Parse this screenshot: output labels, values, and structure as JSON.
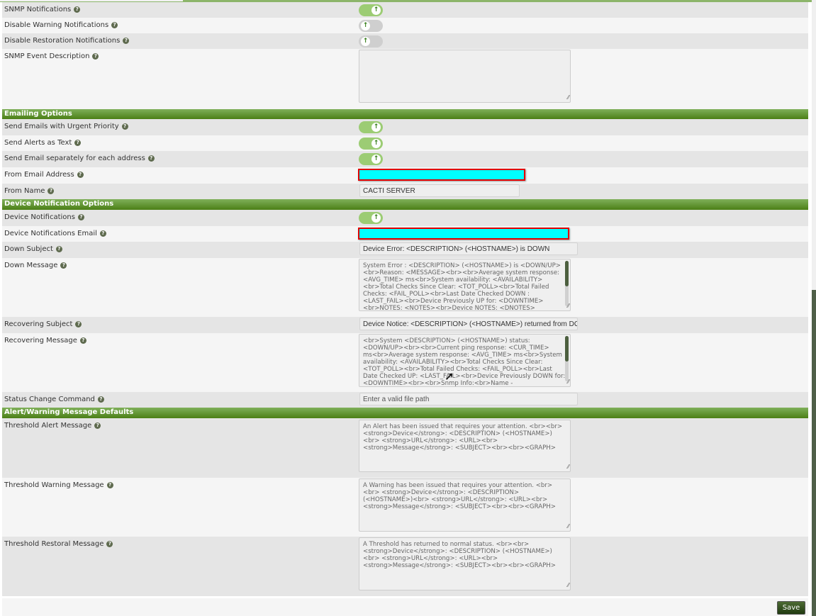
{
  "sections": {
    "snmp": [
      {
        "label": "SNMP Notifications",
        "type": "toggle",
        "on": true
      },
      {
        "label": "Disable Warning Notifications",
        "type": "toggle",
        "on": false
      },
      {
        "label": "Disable Restoration Notifications",
        "type": "toggle",
        "on": false
      },
      {
        "label": "SNMP Event Description",
        "type": "textarea",
        "value": ""
      }
    ],
    "emailing": {
      "title": "Emailing Options",
      "rows": [
        {
          "label": "Send Emails with Urgent Priority",
          "type": "toggle",
          "on": true
        },
        {
          "label": "Send Alerts as Text",
          "type": "toggle",
          "on": true
        },
        {
          "label": "Send Email separately for each address",
          "type": "toggle",
          "on": true
        },
        {
          "label": "From Email Address",
          "type": "input",
          "value": "",
          "redacted": true
        },
        {
          "label": "From Name",
          "type": "input",
          "value": "CACTI SERVER"
        }
      ]
    },
    "device": {
      "title": "Device Notification Options",
      "rows": [
        {
          "label": "Device Notifications",
          "type": "toggle",
          "on": true
        },
        {
          "label": "Device Notifications Email",
          "type": "input",
          "value": "",
          "redacted": true
        },
        {
          "label": "Down Subject",
          "type": "input",
          "value": "Device Error: <DESCRIPTION> (<HOSTNAME>) is DOWN"
        },
        {
          "label": "Down Message",
          "type": "textarea",
          "value": "System Error : <DESCRIPTION> (<HOSTNAME>) is <DOWN/UP> <br>Reason: <MESSAGE><br><br>Average system response: <AVG_TIME> ms<br>System availability: <AVAILABILITY> <br>Total Checks Since Clear: <TOT_POLL><br>Total Failed Checks: <FAIL_POLL><br>Last Date Checked DOWN : <LAST_FAIL><br>Device Previously UP for: <DOWNTIME> <br>NOTES: <NOTES><br>Device NOTES: <DNOTES>"
        },
        {
          "label": "Recovering Subject",
          "type": "input",
          "value": "Device Notice: <DESCRIPTION> (<HOSTNAME>) returned from DOWN st"
        },
        {
          "label": "Recovering Message",
          "type": "textarea",
          "value": "<br>System <DESCRIPTION> (<HOSTNAME>) status: <DOWN/UP><br><br>Current ping response: <CUR_TIME> ms<br>Average system response: <AVG_TIME> ms<br>System availability: <AVAILABILITY><br>Total Checks Since Clear: <TOT_POLL><br>Total Failed Checks: <FAIL_POLL><br>Last Date Checked UP: <LAST_FAIL><br>Device Previously DOWN for: <DOWNTIME><br><br>Snmp Info:<br>Name -"
        },
        {
          "label": "Status Change Command",
          "type": "input",
          "value": "",
          "placeholder": "Enter a valid file path"
        }
      ]
    },
    "alerts": {
      "title": "Alert/Warning Message Defaults",
      "rows": [
        {
          "label": "Threshold Alert Message",
          "type": "textarea",
          "value": "An Alert has been issued that requires your attention. <br><br> <strong>Device</strong>: <DESCRIPTION> (<HOSTNAME>)<br> <strong>URL</strong>: <URL><br><strong>Message</strong>: <SUBJECT><br><br><GRAPH>"
        },
        {
          "label": "Threshold Warning Message",
          "type": "textarea",
          "value": "A Warning has been issued that requires your attention. <br><br> <strong>Device</strong>: <DESCRIPTION> (<HOSTNAME>)<br> <strong>URL</strong>: <URL><br><strong>Message</strong>: <SUBJECT><br><br><GRAPH>"
        },
        {
          "label": "Threshold Restoral Message",
          "type": "textarea",
          "value": "A Threshold has returned to normal status. <br><br> <strong>Device</strong>: <DESCRIPTION> (<HOSTNAME>)<br> <strong>URL</strong>: <URL><br><strong>Message</strong>: <SUBJECT><br><br><GRAPH>"
        }
      ]
    }
  },
  "help_glyph": "?",
  "toggle_glyph": "↑",
  "save_label": "Save",
  "colors": {
    "header_green": "#4b7f16",
    "toggle_on": "#9ccc74",
    "redaction": "#00ffff"
  }
}
